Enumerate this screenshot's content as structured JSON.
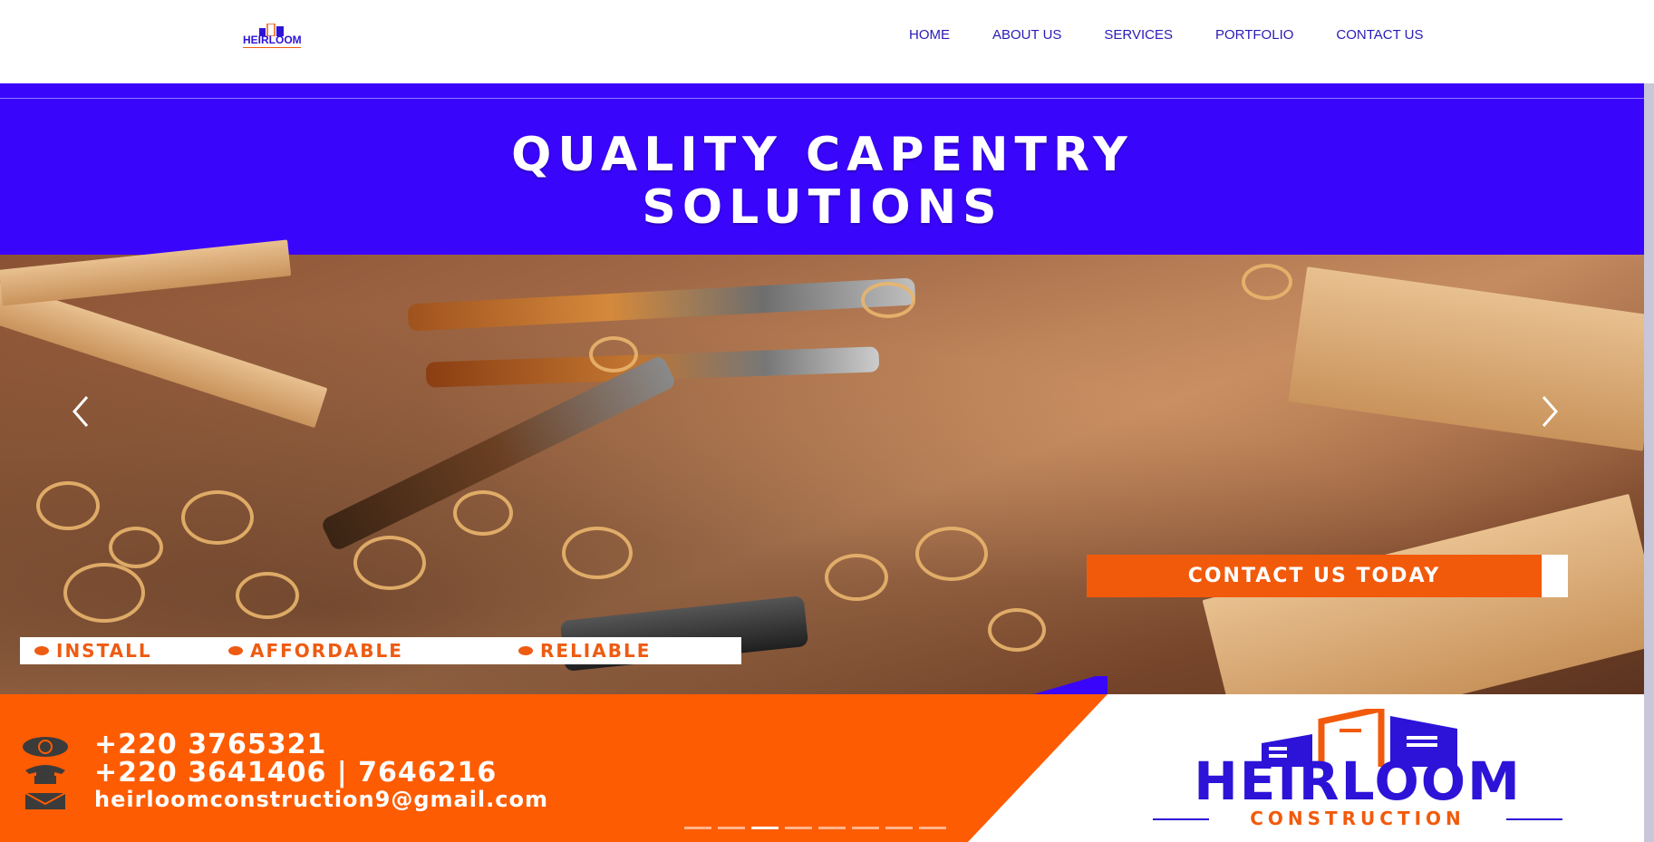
{
  "nav": {
    "logo_text": "HEIRLOOM",
    "links": [
      "HOME",
      "ABOUT US",
      "SERVICES",
      "PORTFOLIO",
      "CONTACT US"
    ]
  },
  "hero": {
    "title_line1": "QUALITY CAPENTRY",
    "title_line2": "SOLUTIONS",
    "benefits": [
      "INSTALL",
      "AFFORDABLE",
      "RELIABLE"
    ],
    "cta_label": "CONTACT US TODAY",
    "phone_primary": "+220 3765321",
    "phone_secondary": "+220 3641406 | 7646216",
    "email": "heirloomconstruction9@gmail.com",
    "logo_brand": "HEIRLOOM",
    "logo_sub": "CONSTRUCTION"
  },
  "carousel": {
    "slide_count": 8,
    "active_index": 2
  },
  "colors": {
    "brand_blue": "#3a06fb",
    "brand_orange": "#fe5c02",
    "nav_text": "#2a1ab8"
  },
  "icons": {
    "prev": "chevron-left-icon",
    "next": "chevron-right-icon",
    "whatsapp": "whatsapp-icon",
    "phone": "telephone-icon",
    "email": "envelope-icon"
  }
}
